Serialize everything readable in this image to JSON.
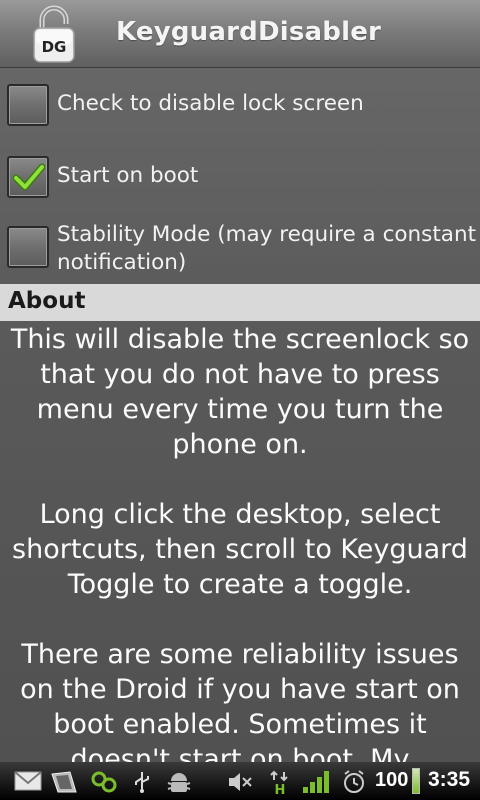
{
  "app": {
    "title": "KeyguardDisabler",
    "icon_label": "DG"
  },
  "settings": [
    {
      "label": "Check to disable lock screen",
      "checked": false
    },
    {
      "label": "Start on boot",
      "checked": true
    },
    {
      "label_line1": "Stability Mode (may require a constant",
      "label_line2": "notification)",
      "checked": false
    }
  ],
  "about": {
    "header": "About",
    "paragraphs": [
      "This will disable the screenlock so that you do not have to press menu every time you turn the phone on.",
      "Long click the desktop, select shortcuts, then scroll to Keyguard Toggle to create a toggle.",
      "There are some reliability issues on the Droid if you have start on boot enabled. Sometimes it doesn't start on boot. My"
    ]
  },
  "status_bar": {
    "battery_percent": "100",
    "time": "3:35",
    "network_type": "H",
    "icons": [
      "gmail-icon",
      "sim-tool-icon",
      "sync-icon",
      "usb-icon",
      "android-debug-icon",
      "mute-icon",
      "data-arrows-icon",
      "signal-icon",
      "alarm-icon",
      "battery-icon"
    ],
    "colors": {
      "signal": "#7bbd2a",
      "data": "#7bbd2a"
    }
  },
  "colors": {
    "check_mark": "#7fd12b",
    "about_header_bg": "#d9d9d9",
    "background": "#5e5e5e"
  }
}
